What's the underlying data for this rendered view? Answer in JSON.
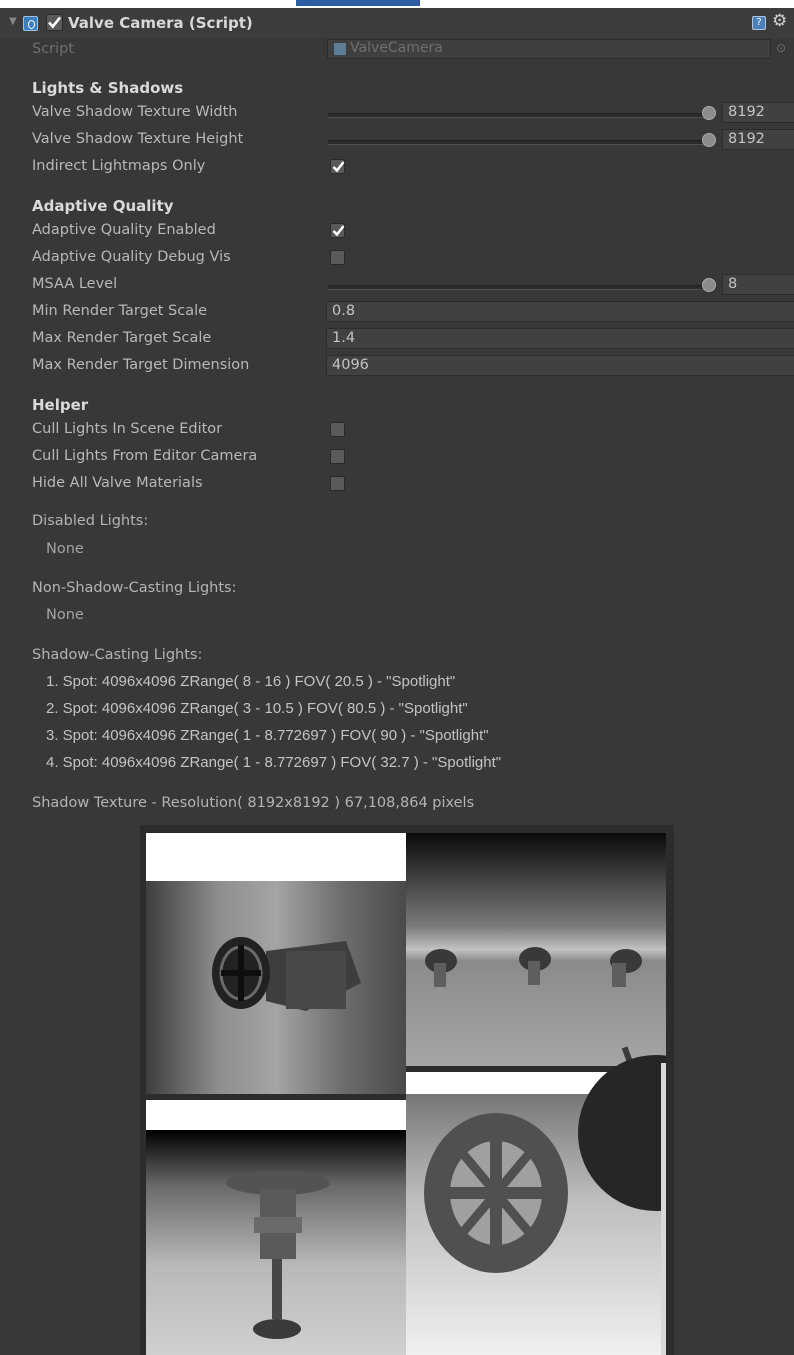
{
  "component": {
    "title": "Valve Camera (Script)",
    "enabled": true,
    "fold_arrow": "fold-down-triangle",
    "icons": [
      "script-icon",
      "help-icon",
      "gear-icon"
    ]
  },
  "script_field": {
    "label": "Script",
    "value": "ValveCamera",
    "picker": "⊙"
  },
  "lights_shadows": {
    "heading": "Lights & Shadows",
    "shadow_width": {
      "label": "Valve Shadow Texture Width",
      "value": "8192"
    },
    "shadow_height": {
      "label": "Valve Shadow Texture Height",
      "value": "8192"
    },
    "indirect_only": {
      "label": "Indirect Lightmaps Only",
      "checked": true
    }
  },
  "adaptive": {
    "heading": "Adaptive Quality",
    "enabled": {
      "label": "Adaptive Quality Enabled",
      "checked": true
    },
    "debug_vis": {
      "label": "Adaptive Quality Debug Vis",
      "checked": false
    },
    "msaa": {
      "label": "MSAA Level",
      "value": "8"
    },
    "min_scale": {
      "label": "Min Render Target Scale",
      "value": "0.8"
    },
    "max_scale": {
      "label": "Max Render Target Scale",
      "value": "1.4"
    },
    "max_dim": {
      "label": "Max Render Target Dimension",
      "value": "4096"
    }
  },
  "helper": {
    "heading": "Helper",
    "cull_scene": {
      "label": "Cull Lights In Scene Editor",
      "checked": false
    },
    "cull_camera": {
      "label": "Cull Lights From Editor Camera",
      "checked": false
    },
    "hide_materials": {
      "label": "Hide All Valve Materials",
      "checked": false
    }
  },
  "disabled_lights": {
    "heading": "Disabled Lights:",
    "value": "None"
  },
  "non_shadow_lights": {
    "heading": "Non-Shadow-Casting Lights:",
    "value": "None"
  },
  "shadow_lights": {
    "heading": "Shadow-Casting Lights:",
    "items": [
      "1. Spot: 4096x4096 ZRange( 8 - 16 ) FOV( 20.5 ) - \"Spotlight\"",
      "2. Spot: 4096x4096 ZRange( 3 - 10.5 ) FOV( 80.5 ) - \"Spotlight\"",
      "3. Spot: 4096x4096 ZRange( 1 - 8.772697 ) FOV( 90 ) - \"Spotlight\"",
      "4. Spot: 4096x4096 ZRange( 1 - 8.772697 ) FOV( 32.7 ) - \"Spotlight\""
    ]
  },
  "shadow_texture": {
    "caption": "Shadow Texture - Resolution( 8192x8192 ) 67,108,864 pixels",
    "preview": "shadow-atlas-depth-preview"
  },
  "colors": {
    "panel_bg": "#383838",
    "header_bg": "#3c3c3c",
    "field_bg": "#414141",
    "label_text": "#b8b8b8",
    "heading_text": "#dadada",
    "top_accent": "#2c5ea3"
  }
}
